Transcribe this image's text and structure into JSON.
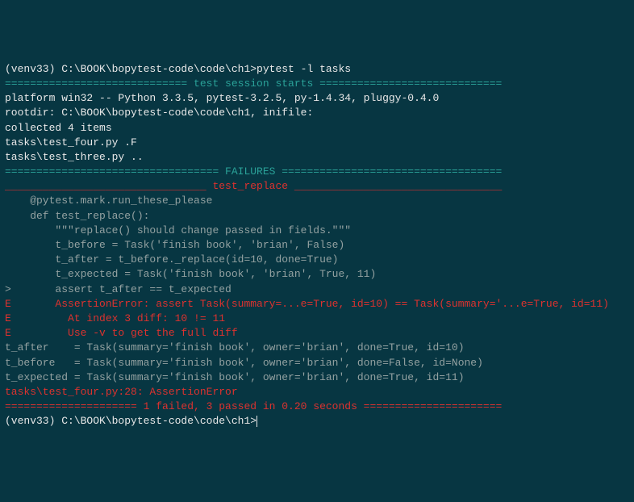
{
  "lines": [
    {
      "cls": "white",
      "text": "(venv33) C:\\BOOK\\bopytest-code\\code\\ch1>pytest -l tasks"
    },
    {
      "cls": "cyan",
      "text": "============================= test session starts ============================="
    },
    {
      "cls": "white",
      "text": "platform win32 -- Python 3.3.5, pytest-3.2.5, py-1.4.34, pluggy-0.4.0"
    },
    {
      "cls": "white",
      "text": "rootdir: C:\\BOOK\\bopytest-code\\code\\ch1, inifile:"
    },
    {
      "cls": "white",
      "text": "collected 4 items"
    },
    {
      "cls": "white",
      "text": ""
    },
    {
      "cls": "white",
      "text": "tasks\\test_four.py .F"
    },
    {
      "cls": "white",
      "text": "tasks\\test_three.py .."
    },
    {
      "cls": "white",
      "text": ""
    },
    {
      "cls": "cyan",
      "text": "================================== FAILURES ==================================="
    },
    {
      "cls": "red",
      "text": "________________________________ test_replace _________________________________"
    },
    {
      "cls": "white",
      "text": ""
    },
    {
      "cls": "gray",
      "text": "    @pytest.mark.run_these_please"
    },
    {
      "cls": "gray",
      "text": "    def test_replace():"
    },
    {
      "cls": "gray",
      "text": "        \"\"\"replace() should change passed in fields.\"\"\""
    },
    {
      "cls": "gray",
      "text": "        t_before = Task('finish book', 'brian', False)"
    },
    {
      "cls": "gray",
      "text": "        t_after = t_before._replace(id=10, done=True)"
    },
    {
      "cls": "gray",
      "text": "        t_expected = Task('finish book', 'brian', True, 11)"
    },
    {
      "cls": "gray",
      "text": ">       assert t_after == t_expected"
    },
    {
      "cls": "red",
      "text": "E       AssertionError: assert Task(summary=...e=True, id=10) == Task(summary='...e=True, id=11)"
    },
    {
      "cls": "red",
      "text": "E         At index 3 diff: 10 != 11"
    },
    {
      "cls": "red",
      "text": "E         Use -v to get the full diff"
    },
    {
      "cls": "white",
      "text": ""
    },
    {
      "cls": "gray",
      "text": "t_after    = Task(summary='finish book', owner='brian', done=True, id=10)"
    },
    {
      "cls": "gray",
      "text": "t_before   = Task(summary='finish book', owner='brian', done=False, id=None)"
    },
    {
      "cls": "gray",
      "text": "t_expected = Task(summary='finish book', owner='brian', done=True, id=11)"
    },
    {
      "cls": "white",
      "text": ""
    },
    {
      "cls": "red",
      "text": "tasks\\test_four.py:28: AssertionError"
    },
    {
      "cls": "red",
      "text": "===================== 1 failed, 3 passed in 0.20 seconds ======================"
    },
    {
      "cls": "white",
      "text": ""
    }
  ],
  "prompt": "(venv33) C:\\BOOK\\bopytest-code\\code\\ch1>"
}
